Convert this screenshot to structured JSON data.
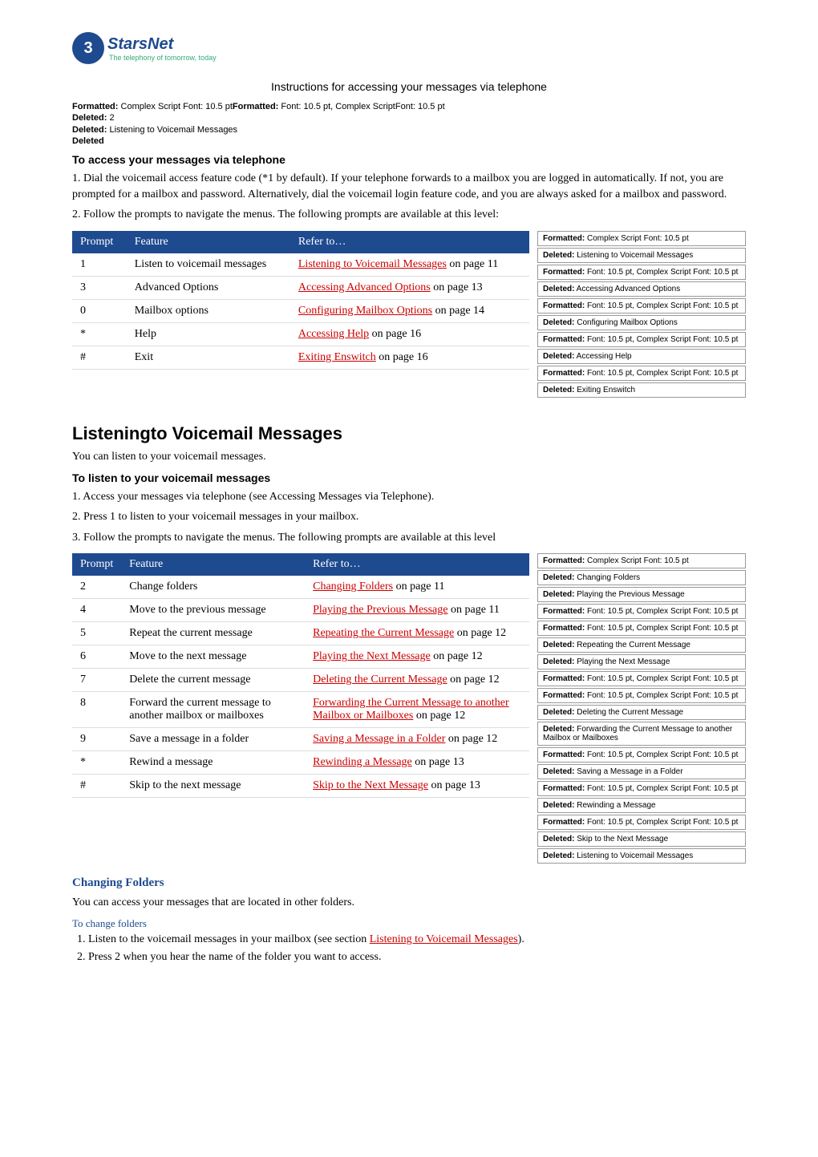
{
  "logo": {
    "num": "3",
    "name": "StarsNet",
    "tag": "The telephony of tomorrow, today"
  },
  "title": "Instructions for accessing your messages via telephone",
  "meta": [
    {
      "b": "Formatted:",
      "t": " Complex Script Font: 10.5 pt"
    },
    {
      "b": "Formatted:",
      "t": " Font: 10.5 pt, Complex ScriptFont: 10.5 pt"
    }
  ],
  "metaLines": [
    {
      "b": "Deleted:",
      "t": " 2"
    },
    {
      "b": "Deleted:",
      "t": " Listening to Voicemail Messages"
    },
    {
      "b": "Deleted",
      "t": ""
    }
  ],
  "accessHeading": "To access your messages via telephone",
  "accessSteps": [
    "1. Dial the voicemail access feature code (*1 by default). If your telephone forwards to a mailbox you are logged in automatically. If not, you are prompted for a mailbox and password. Alternatively, dial the voicemail login feature code, and you are always asked for a mailbox and password.",
    "2. Follow the prompts to navigate the menus. The following prompts are available at this level:"
  ],
  "table1": {
    "headers": [
      "Prompt",
      "Feature",
      "Refer to…"
    ],
    "rows": [
      {
        "p": "1",
        "f": "Listen to voicemail messages",
        "l": "Listening to Voicemail Messages",
        "pg": " on page 11"
      },
      {
        "p": "3",
        "f": "Advanced Options",
        "l": "Accessing Advanced Options",
        "pg": " on page 13"
      },
      {
        "p": "0",
        "f": "Mailbox options",
        "l": "Configuring Mailbox Options",
        "pg": " on page 14"
      },
      {
        "p": "*",
        "f": "Help",
        "l": "Accessing Help",
        "pg": " on page 16"
      },
      {
        "p": "#",
        "f": "Exit",
        "l": "Exiting Enswitch",
        "pg": " on page 16"
      }
    ]
  },
  "comments1": [
    {
      "b": "Formatted:",
      "t": " Complex Script Font: 10.5 pt"
    },
    {
      "b": "Deleted:",
      "t": " Listening to Voicemail Messages"
    },
    {
      "b": "Formatted:",
      "t": " Font: 10.5 pt, Complex Script Font: 10.5 pt"
    },
    {
      "b": "Deleted:",
      "t": " Accessing Advanced Options"
    },
    {
      "b": "Formatted:",
      "t": " Font: 10.5 pt, Complex Script Font: 10.5 pt"
    },
    {
      "b": "Deleted:",
      "t": " Configuring Mailbox Options"
    },
    {
      "b": "Formatted:",
      "t": " Font: 10.5 pt, Complex Script Font: 10.5 pt"
    },
    {
      "b": "Deleted:",
      "t": " Accessing Help"
    },
    {
      "b": "Formatted:",
      "t": " Font: 10.5 pt, Complex Script Font: 10.5 pt"
    },
    {
      "b": "Deleted:",
      "t": " Exiting Enswitch"
    }
  ],
  "h2": "Listeningto Voicemail Messages",
  "listenIntro": "You can listen to your voicemail messages.",
  "listenHeading": "To listen to your voicemail messages",
  "listenSteps": [
    "1. Access your messages via telephone (see Accessing Messages via Telephone).",
    "2. Press 1 to listen to your voicemail messages in your mailbox.",
    "3. Follow the prompts to navigate the menus. The following prompts are available at this level"
  ],
  "table2": {
    "headers": [
      "Prompt",
      "Feature",
      "Refer to…"
    ],
    "rows": [
      {
        "p": "2",
        "f": "Change folders",
        "l": "Changing Folders",
        "pg": " on page 11"
      },
      {
        "p": "4",
        "f": "Move to the previous message",
        "l": "Playing the Previous Message",
        "pg": " on page 11"
      },
      {
        "p": "5",
        "f": "Repeat the current message",
        "l": "Repeating the Current Message",
        "pg": " on page 12"
      },
      {
        "p": "6",
        "f": "Move to the next message",
        "l": "Playing the Next Message",
        "pg": " on page 12"
      },
      {
        "p": "7",
        "f": "Delete the current message",
        "l": "Deleting the Current Message",
        "pg": " on page 12"
      },
      {
        "p": "8",
        "f": "Forward the current message to another mailbox or mailboxes",
        "l": "Forwarding the Current Message to another Mailbox or Mailboxes",
        "pg": " on page 12"
      },
      {
        "p": "9",
        "f": "Save a message in a folder",
        "l": "Saving a Message in a Folder",
        "pg": " on page 12"
      },
      {
        "p": "*",
        "f": "Rewind a message",
        "l": "Rewinding a Message",
        "pg": " on page 13"
      },
      {
        "p": "#",
        "f": "Skip to the next message",
        "l": "Skip to the Next Message",
        "pg": " on page 13"
      }
    ]
  },
  "comments2": [
    {
      "b": "Formatted:",
      "t": " Complex Script Font: 10.5 pt"
    },
    {
      "b": "Deleted:",
      "t": " Changing Folders"
    },
    {
      "b": "Deleted:",
      "t": " Playing the Previous Message"
    },
    {
      "b": "Formatted:",
      "t": " Font: 10.5 pt, Complex Script Font: 10.5 pt"
    },
    {
      "b": "Formatted:",
      "t": " Font: 10.5 pt, Complex Script Font: 10.5 pt"
    },
    {
      "b": "Deleted:",
      "t": " Repeating the Current Message"
    },
    {
      "b": "Deleted:",
      "t": " Playing the Next Message"
    },
    {
      "b": "Formatted:",
      "t": " Font: 10.5 pt, Complex Script Font: 10.5 pt"
    },
    {
      "b": "Formatted:",
      "t": " Font: 10.5 pt, Complex Script Font: 10.5 pt"
    },
    {
      "b": "Deleted:",
      "t": " Deleting the Current Message"
    },
    {
      "b": "Deleted:",
      "t": " Forwarding the Current Message to another Mailbox or Mailboxes"
    },
    {
      "b": "Formatted:",
      "t": " Font: 10.5 pt, Complex Script Font: 10.5 pt"
    },
    {
      "b": "Deleted:",
      "t": " Saving a Message in a Folder"
    },
    {
      "b": "Formatted:",
      "t": " Font: 10.5 pt, Complex Script Font: 10.5 pt"
    },
    {
      "b": "Deleted:",
      "t": " Rewinding a Message"
    },
    {
      "b": "Formatted:",
      "t": " Font: 10.5 pt, Complex Script Font: 10.5 pt"
    },
    {
      "b": "Deleted:",
      "t": " Skip to the Next Message"
    },
    {
      "b": "Deleted:",
      "t": " Listening to Voicemail Messages"
    }
  ],
  "changingFolders": {
    "h": "Changing Folders",
    "p": "You can access your messages that are located in other folders.",
    "sub": "To change folders",
    "steps": [
      {
        "n": "1.",
        "pre": "Listen to the voicemail messages in your mailbox (see section ",
        "link": "Listening to Voicemail Messages",
        "post": ")."
      },
      {
        "n": "2.",
        "pre": "Press 2 when you hear the name of the folder you want to access.",
        "link": "",
        "post": ""
      }
    ]
  }
}
